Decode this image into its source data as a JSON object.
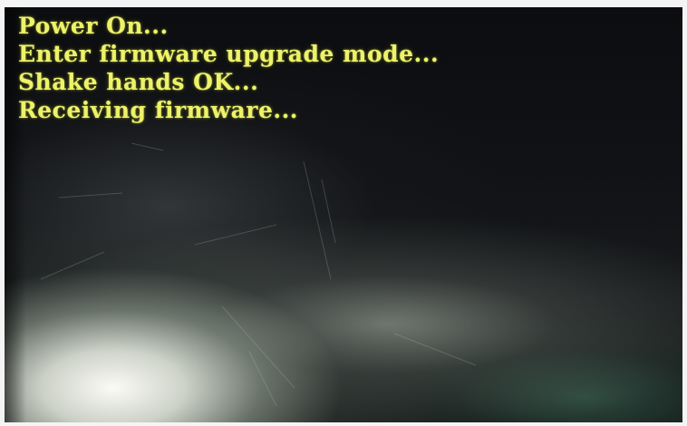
{
  "terminal": {
    "lines": [
      "Power On...",
      "Enter firmware upgrade mode...",
      "Shake hands OK...",
      "Receiving firmware..."
    ]
  },
  "colors": {
    "text": "#eef26a",
    "background": "#0c0d10"
  }
}
